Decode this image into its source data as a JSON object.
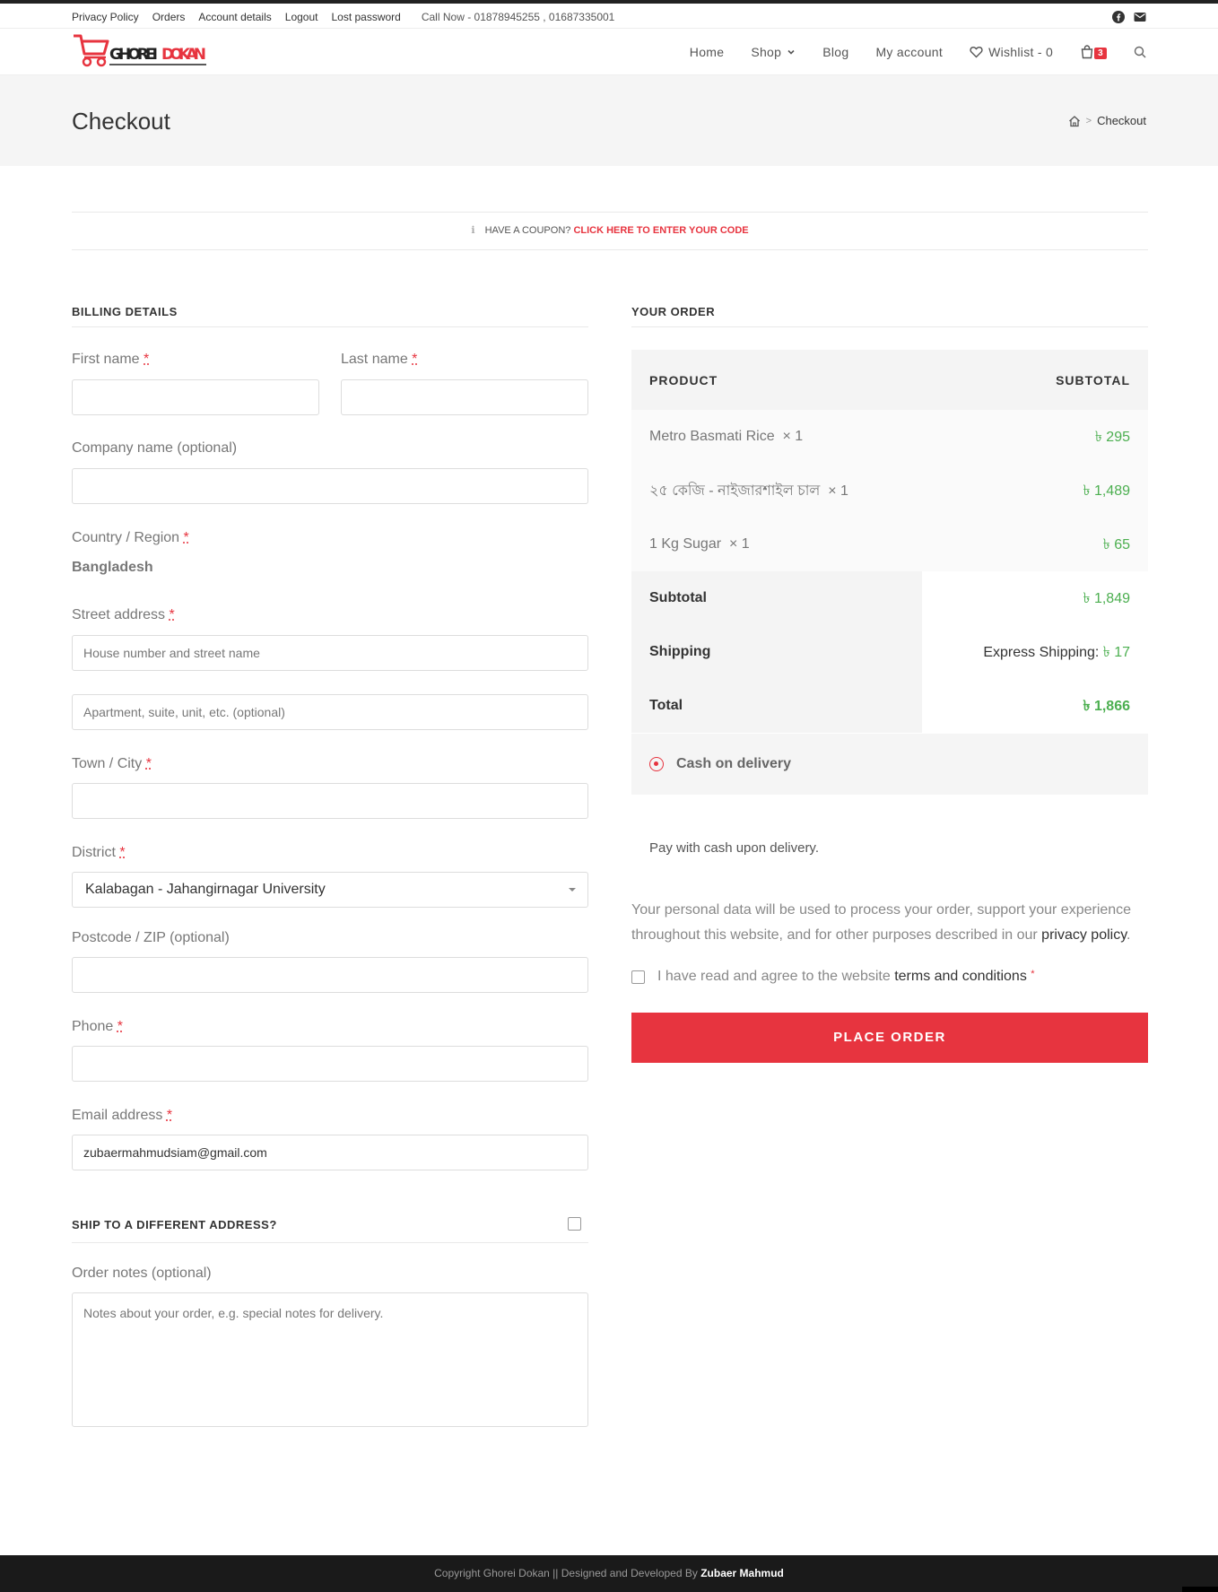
{
  "topbar": {
    "links": [
      "Privacy Policy",
      "Orders",
      "Account details",
      "Logout",
      "Lost password"
    ],
    "call_now": "Call Now - 01878945255 , 01687335001",
    "social": [
      "facebook-icon",
      "envelope-icon"
    ]
  },
  "header": {
    "logo_text": "GHOREI DOKAN",
    "nav": {
      "home": "Home",
      "shop": "Shop",
      "blog": "Blog",
      "account": "My account",
      "wishlist": "Wishlist - 0",
      "cart_count": "3"
    }
  },
  "page": {
    "title": "Checkout",
    "breadcrumb_current": "Checkout"
  },
  "coupon": {
    "question": "Have a coupon?",
    "link": "Click here to enter your code"
  },
  "billing": {
    "title": "BILLING DETAILS",
    "first_name_label": "First name",
    "last_name_label": "Last name",
    "company_label": "Company name (optional)",
    "country_label": "Country / Region",
    "country_value": "Bangladesh",
    "street_label": "Street address",
    "street_placeholder": "House number and street name",
    "apartment_placeholder": "Apartment, suite, unit, etc. (optional)",
    "city_label": "Town / City",
    "district_label": "District",
    "district_value": "Kalabagan - Jahangirnagar University",
    "postcode_label": "Postcode / ZIP (optional)",
    "phone_label": "Phone",
    "email_label": "Email address",
    "email_value": "zubaermahmudsiam@gmail.com",
    "required_mark": "*"
  },
  "shipping": {
    "title": "SHIP TO A DIFFERENT ADDRESS?",
    "notes_label": "Order notes (optional)",
    "notes_placeholder": "Notes about your order, e.g. special notes for delivery."
  },
  "order": {
    "title": "YOUR ORDER",
    "col_product": "PRODUCT",
    "col_subtotal": "SUBTOTAL",
    "items": [
      {
        "name": "Metro Basmati Rice",
        "qty": "× 1",
        "price": "৳ 295"
      },
      {
        "name": "২৫ কেজি - নাইজারশাইল চাল",
        "qty": "× 1",
        "price": "৳ 1,489"
      },
      {
        "name": "1 Kg Sugar",
        "qty": "× 1",
        "price": "৳ 65"
      }
    ],
    "subtotal_label": "Subtotal",
    "subtotal_value": "৳ 1,849",
    "shipping_label": "Shipping",
    "shipping_method": "Express Shipping:",
    "shipping_value": "৳ 17",
    "total_label": "Total",
    "total_value": "৳ 1,866"
  },
  "payment": {
    "method": "Cash on delivery",
    "description": "Pay with cash upon delivery.",
    "privacy_text": "Your personal data will be used to process your order, support your experience throughout this website, and for other purposes described in our",
    "privacy_link": "privacy policy",
    "terms_text": "I have read and agree to the website",
    "terms_link": "terms and conditions",
    "place_order": "PLACE ORDER"
  },
  "footer": {
    "text": "Copyright Ghorei Dokan || Designed and Developed By",
    "author": "Zubaer Mahmud"
  },
  "colors": {
    "accent": "#e7343f",
    "price_green": "#4caf50"
  }
}
